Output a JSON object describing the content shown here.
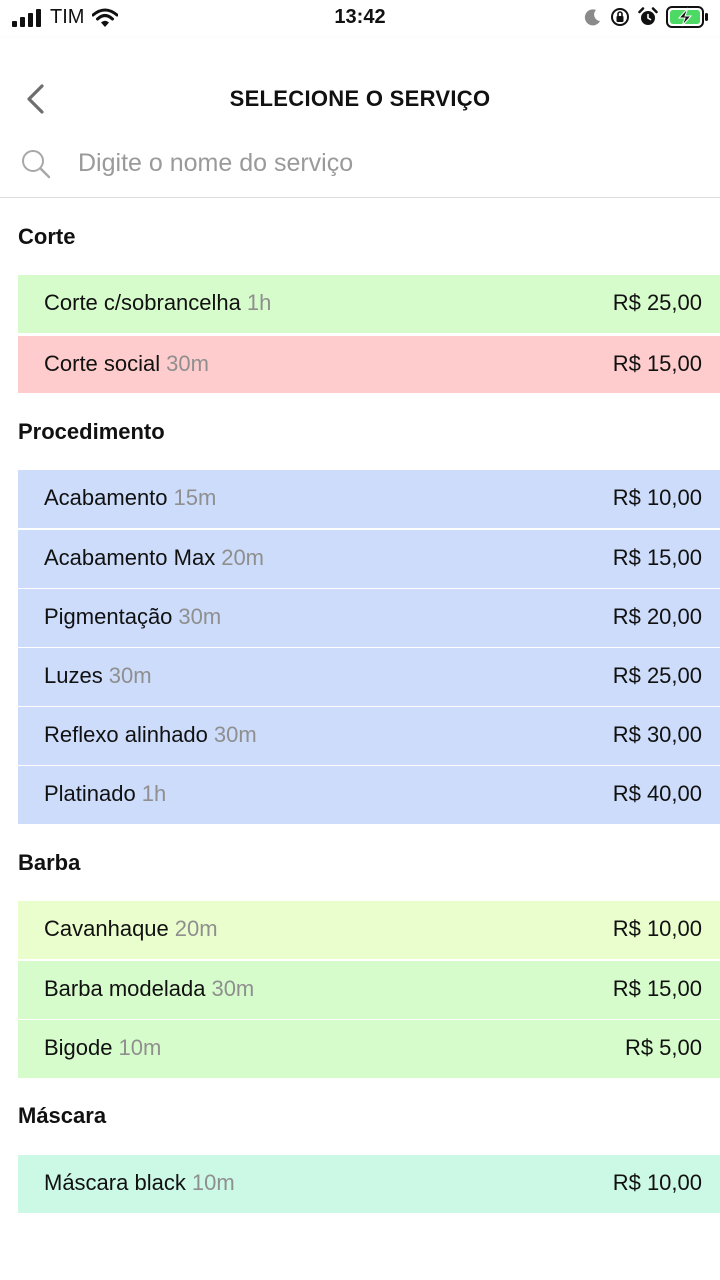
{
  "status": {
    "carrier": "TIM",
    "time": "13:42"
  },
  "header": {
    "title": "SELECIONE O SERVIÇO"
  },
  "search": {
    "placeholder": "Digite o nome do serviço"
  },
  "categories": [
    {
      "name": "Corte",
      "items": [
        {
          "name": "Corte c/sobrancelha",
          "duration": "1h",
          "price": "R$ 25,00",
          "color": "#d7fccc"
        },
        {
          "name": "Corte social",
          "duration": "30m",
          "price": "R$ 15,00",
          "color": "#fecccc"
        }
      ]
    },
    {
      "name": "Procedimento",
      "items": [
        {
          "name": "Acabamento",
          "duration": "15m",
          "price": "R$ 10,00",
          "color": "#ccdcfa"
        },
        {
          "name": "Acabamento Max",
          "duration": "20m",
          "price": "R$ 15,00",
          "color": "#ccdcfa"
        },
        {
          "name": "Pigmentação",
          "duration": "30m",
          "price": "R$ 20,00",
          "color": "#ccdcfa"
        },
        {
          "name": "Luzes",
          "duration": "30m",
          "price": "R$ 25,00",
          "color": "#ccdcfa"
        },
        {
          "name": "Reflexo alinhado",
          "duration": "30m",
          "price": "R$ 30,00",
          "color": "#ccdcfa"
        },
        {
          "name": "Platinado",
          "duration": "1h",
          "price": "R$ 40,00",
          "color": "#ccdcfa"
        }
      ]
    },
    {
      "name": "Barba",
      "items": [
        {
          "name": "Cavanhaque",
          "duration": "20m",
          "price": "R$ 10,00",
          "color": "#eafdcc"
        },
        {
          "name": "Barba modelada",
          "duration": "30m",
          "price": "R$ 15,00",
          "color": "#d7fccc"
        },
        {
          "name": "Bigode",
          "duration": "10m",
          "price": "R$ 5,00",
          "color": "#d7fccc"
        }
      ]
    },
    {
      "name": "Máscara",
      "items": [
        {
          "name": "Máscara black",
          "duration": "10m",
          "price": "R$ 10,00",
          "color": "#ccf9e6"
        }
      ]
    }
  ]
}
